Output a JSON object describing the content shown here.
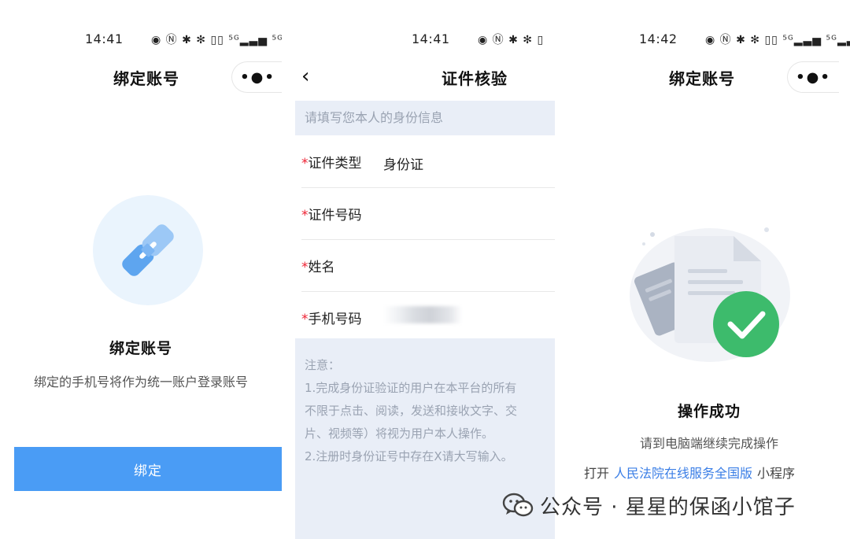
{
  "panel1": {
    "status_time": "14:41",
    "status_icons": "◉ Ⓝ ✱ ✻ ▯▯ ⁵ᴳ▂▃▅ ⁵ᴳ▂▃▅ ▯",
    "title": "绑定账号",
    "capsule_dots": "•●•",
    "heading": "绑定账号",
    "description": "绑定的手机号将作为统一账户登录账号",
    "button_label": "绑定",
    "accent_color": "#4a9cf5"
  },
  "panel2": {
    "status_time": "14:41",
    "status_icons": "◉ Ⓝ ✱ ✻ ▯",
    "back_glyph": "‹",
    "title": "证件核验",
    "hint": "请填写您本人的身份信息",
    "fields": [
      {
        "required_mark": "*",
        "label": "证件类型",
        "value": "身份证"
      },
      {
        "required_mark": "*",
        "label": "证件号码",
        "value": ""
      },
      {
        "required_mark": "*",
        "label": "姓名",
        "value": ""
      },
      {
        "required_mark": "*",
        "label": "手机号码",
        "value": ""
      }
    ],
    "notice_lines": [
      "注意：",
      "1.完成身份证验证的用户在本平台的所有",
      "不限于点击、阅读，发送和接收文字、交",
      "片、视频等）将视为用户本人操作。",
      "2.注册时身份证号中存在X请大写输入。"
    ]
  },
  "panel3": {
    "status_time": "14:42",
    "status_icons": "◉ Ⓝ ✱ ✻ ▯▯ ⁵ᴳ▂▃▅ ⁵ᴳ▂▃▅ ▯",
    "title": "绑定账号",
    "capsule_dots": "•●•",
    "success_title": "操作成功",
    "success_desc": "请到电脑端继续完成操作",
    "open_prefix": "打开",
    "open_link": "人民法院在线服务全国版",
    "open_suffix": "小程序",
    "success_color": "#3dbb6c",
    "link_color": "#3a7ee6"
  },
  "watermark": {
    "text": "公众号 · 星星的保函小馆子"
  }
}
